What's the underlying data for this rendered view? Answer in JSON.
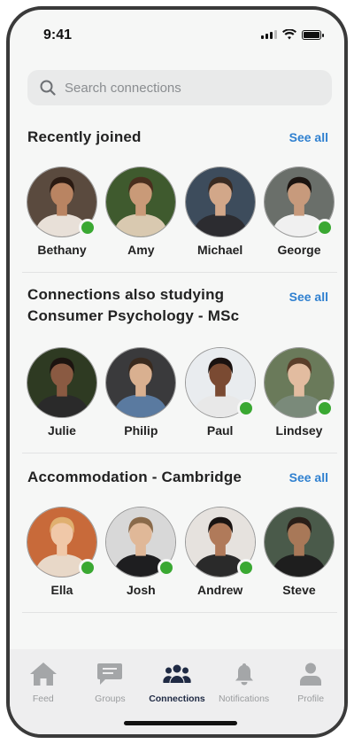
{
  "status": {
    "time": "9:41"
  },
  "search": {
    "placeholder": "Search connections"
  },
  "sections": [
    {
      "title": "Recently joined",
      "see_all": "See all",
      "people": [
        {
          "name": "Bethany",
          "online": true,
          "bg": "#5a4a3e",
          "skin": "#b98462",
          "hair": "#2a1a12",
          "shirt": "#e8e0d8"
        },
        {
          "name": "Amy",
          "online": false,
          "bg": "#3f5a2e",
          "skin": "#c99a78",
          "hair": "#4a2e1e",
          "shirt": "#d9c9b0"
        },
        {
          "name": "Michael",
          "online": false,
          "bg": "#3d4c5c",
          "skin": "#d2a789",
          "hair": "#3a2b22",
          "shirt": "#2c2c30"
        },
        {
          "name": "George",
          "online": true,
          "bg": "#6a6f6a",
          "skin": "#c79a7c",
          "hair": "#1c1410",
          "shirt": "#f0f0f0"
        }
      ]
    },
    {
      "title_lines": [
        "Connections also studying",
        "Consumer Psychology - MSc"
      ],
      "see_all": "See all",
      "people": [
        {
          "name": "Julie",
          "online": false,
          "bg": "#2e3a22",
          "skin": "#8a5a42",
          "hair": "#1c1410",
          "shirt": "#2a2a2a"
        },
        {
          "name": "Philip",
          "online": false,
          "bg": "#3a3a3c",
          "skin": "#d9b090",
          "hair": "#3a2a1e",
          "shirt": "#5a7aa0"
        },
        {
          "name": "Paul",
          "online": true,
          "bg": "#e9ecef",
          "skin": "#7a4a32",
          "hair": "#1a1210",
          "shirt": "#e8e8e8"
        },
        {
          "name": "Lindsey",
          "online": true,
          "bg": "#6a7a5a",
          "skin": "#e2bca0",
          "hair": "#5a3e2a",
          "shirt": "#7a8a7a"
        }
      ]
    },
    {
      "title": "Accommodation - Cambridge",
      "see_all": "See all",
      "people": [
        {
          "name": "Ella",
          "online": true,
          "bg": "#c86a3a",
          "skin": "#f0c8a8",
          "hair": "#e0b070",
          "shirt": "#e8d8c8"
        },
        {
          "name": "Josh",
          "online": true,
          "bg": "#d8d8d8",
          "skin": "#e0b898",
          "hair": "#8a6a4a",
          "shirt": "#1e1e20"
        },
        {
          "name": "Andrew",
          "online": true,
          "bg": "#e6e2de",
          "skin": "#b07a5a",
          "hair": "#1a1412",
          "shirt": "#2a2a2a"
        },
        {
          "name": "Steve",
          "online": false,
          "bg": "#4a5a4a",
          "skin": "#a87858",
          "hair": "#2a1e18",
          "shirt": "#1e1e1e"
        }
      ]
    }
  ],
  "tabs": [
    {
      "label": "Feed",
      "icon": "home-icon",
      "active": false
    },
    {
      "label": "Groups",
      "icon": "chat-icon",
      "active": false
    },
    {
      "label": "Connections",
      "icon": "people-icon",
      "active": true
    },
    {
      "label": "Notifications",
      "icon": "bell-icon",
      "active": false
    },
    {
      "label": "Profile",
      "icon": "person-icon",
      "active": false
    }
  ],
  "colors": {
    "accent": "#2f80d0",
    "online": "#3aa832",
    "active_tab": "#1f2a44",
    "inactive_tab": "#a4a6a8"
  }
}
